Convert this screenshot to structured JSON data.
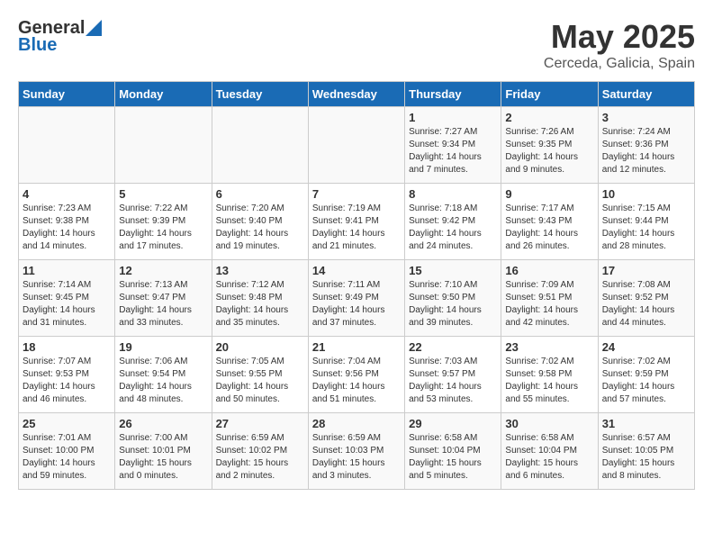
{
  "header": {
    "logo_general": "General",
    "logo_blue": "Blue",
    "month": "May 2025",
    "location": "Cerceda, Galicia, Spain"
  },
  "weekdays": [
    "Sunday",
    "Monday",
    "Tuesday",
    "Wednesday",
    "Thursday",
    "Friday",
    "Saturday"
  ],
  "weeks": [
    [
      {
        "day": "",
        "sunrise": "",
        "sunset": "",
        "daylight": ""
      },
      {
        "day": "",
        "sunrise": "",
        "sunset": "",
        "daylight": ""
      },
      {
        "day": "",
        "sunrise": "",
        "sunset": "",
        "daylight": ""
      },
      {
        "day": "",
        "sunrise": "",
        "sunset": "",
        "daylight": ""
      },
      {
        "day": "1",
        "sunrise": "Sunrise: 7:27 AM",
        "sunset": "Sunset: 9:34 PM",
        "daylight": "Daylight: 14 hours and 7 minutes."
      },
      {
        "day": "2",
        "sunrise": "Sunrise: 7:26 AM",
        "sunset": "Sunset: 9:35 PM",
        "daylight": "Daylight: 14 hours and 9 minutes."
      },
      {
        "day": "3",
        "sunrise": "Sunrise: 7:24 AM",
        "sunset": "Sunset: 9:36 PM",
        "daylight": "Daylight: 14 hours and 12 minutes."
      }
    ],
    [
      {
        "day": "4",
        "sunrise": "Sunrise: 7:23 AM",
        "sunset": "Sunset: 9:38 PM",
        "daylight": "Daylight: 14 hours and 14 minutes."
      },
      {
        "day": "5",
        "sunrise": "Sunrise: 7:22 AM",
        "sunset": "Sunset: 9:39 PM",
        "daylight": "Daylight: 14 hours and 17 minutes."
      },
      {
        "day": "6",
        "sunrise": "Sunrise: 7:20 AM",
        "sunset": "Sunset: 9:40 PM",
        "daylight": "Daylight: 14 hours and 19 minutes."
      },
      {
        "day": "7",
        "sunrise": "Sunrise: 7:19 AM",
        "sunset": "Sunset: 9:41 PM",
        "daylight": "Daylight: 14 hours and 21 minutes."
      },
      {
        "day": "8",
        "sunrise": "Sunrise: 7:18 AM",
        "sunset": "Sunset: 9:42 PM",
        "daylight": "Daylight: 14 hours and 24 minutes."
      },
      {
        "day": "9",
        "sunrise": "Sunrise: 7:17 AM",
        "sunset": "Sunset: 9:43 PM",
        "daylight": "Daylight: 14 hours and 26 minutes."
      },
      {
        "day": "10",
        "sunrise": "Sunrise: 7:15 AM",
        "sunset": "Sunset: 9:44 PM",
        "daylight": "Daylight: 14 hours and 28 minutes."
      }
    ],
    [
      {
        "day": "11",
        "sunrise": "Sunrise: 7:14 AM",
        "sunset": "Sunset: 9:45 PM",
        "daylight": "Daylight: 14 hours and 31 minutes."
      },
      {
        "day": "12",
        "sunrise": "Sunrise: 7:13 AM",
        "sunset": "Sunset: 9:47 PM",
        "daylight": "Daylight: 14 hours and 33 minutes."
      },
      {
        "day": "13",
        "sunrise": "Sunrise: 7:12 AM",
        "sunset": "Sunset: 9:48 PM",
        "daylight": "Daylight: 14 hours and 35 minutes."
      },
      {
        "day": "14",
        "sunrise": "Sunrise: 7:11 AM",
        "sunset": "Sunset: 9:49 PM",
        "daylight": "Daylight: 14 hours and 37 minutes."
      },
      {
        "day": "15",
        "sunrise": "Sunrise: 7:10 AM",
        "sunset": "Sunset: 9:50 PM",
        "daylight": "Daylight: 14 hours and 39 minutes."
      },
      {
        "day": "16",
        "sunrise": "Sunrise: 7:09 AM",
        "sunset": "Sunset: 9:51 PM",
        "daylight": "Daylight: 14 hours and 42 minutes."
      },
      {
        "day": "17",
        "sunrise": "Sunrise: 7:08 AM",
        "sunset": "Sunset: 9:52 PM",
        "daylight": "Daylight: 14 hours and 44 minutes."
      }
    ],
    [
      {
        "day": "18",
        "sunrise": "Sunrise: 7:07 AM",
        "sunset": "Sunset: 9:53 PM",
        "daylight": "Daylight: 14 hours and 46 minutes."
      },
      {
        "day": "19",
        "sunrise": "Sunrise: 7:06 AM",
        "sunset": "Sunset: 9:54 PM",
        "daylight": "Daylight: 14 hours and 48 minutes."
      },
      {
        "day": "20",
        "sunrise": "Sunrise: 7:05 AM",
        "sunset": "Sunset: 9:55 PM",
        "daylight": "Daylight: 14 hours and 50 minutes."
      },
      {
        "day": "21",
        "sunrise": "Sunrise: 7:04 AM",
        "sunset": "Sunset: 9:56 PM",
        "daylight": "Daylight: 14 hours and 51 minutes."
      },
      {
        "day": "22",
        "sunrise": "Sunrise: 7:03 AM",
        "sunset": "Sunset: 9:57 PM",
        "daylight": "Daylight: 14 hours and 53 minutes."
      },
      {
        "day": "23",
        "sunrise": "Sunrise: 7:02 AM",
        "sunset": "Sunset: 9:58 PM",
        "daylight": "Daylight: 14 hours and 55 minutes."
      },
      {
        "day": "24",
        "sunrise": "Sunrise: 7:02 AM",
        "sunset": "Sunset: 9:59 PM",
        "daylight": "Daylight: 14 hours and 57 minutes."
      }
    ],
    [
      {
        "day": "25",
        "sunrise": "Sunrise: 7:01 AM",
        "sunset": "Sunset: 10:00 PM",
        "daylight": "Daylight: 14 hours and 59 minutes."
      },
      {
        "day": "26",
        "sunrise": "Sunrise: 7:00 AM",
        "sunset": "Sunset: 10:01 PM",
        "daylight": "Daylight: 15 hours and 0 minutes."
      },
      {
        "day": "27",
        "sunrise": "Sunrise: 6:59 AM",
        "sunset": "Sunset: 10:02 PM",
        "daylight": "Daylight: 15 hours and 2 minutes."
      },
      {
        "day": "28",
        "sunrise": "Sunrise: 6:59 AM",
        "sunset": "Sunset: 10:03 PM",
        "daylight": "Daylight: 15 hours and 3 minutes."
      },
      {
        "day": "29",
        "sunrise": "Sunrise: 6:58 AM",
        "sunset": "Sunset: 10:04 PM",
        "daylight": "Daylight: 15 hours and 5 minutes."
      },
      {
        "day": "30",
        "sunrise": "Sunrise: 6:58 AM",
        "sunset": "Sunset: 10:04 PM",
        "daylight": "Daylight: 15 hours and 6 minutes."
      },
      {
        "day": "31",
        "sunrise": "Sunrise: 6:57 AM",
        "sunset": "Sunset: 10:05 PM",
        "daylight": "Daylight: 15 hours and 8 minutes."
      }
    ]
  ]
}
